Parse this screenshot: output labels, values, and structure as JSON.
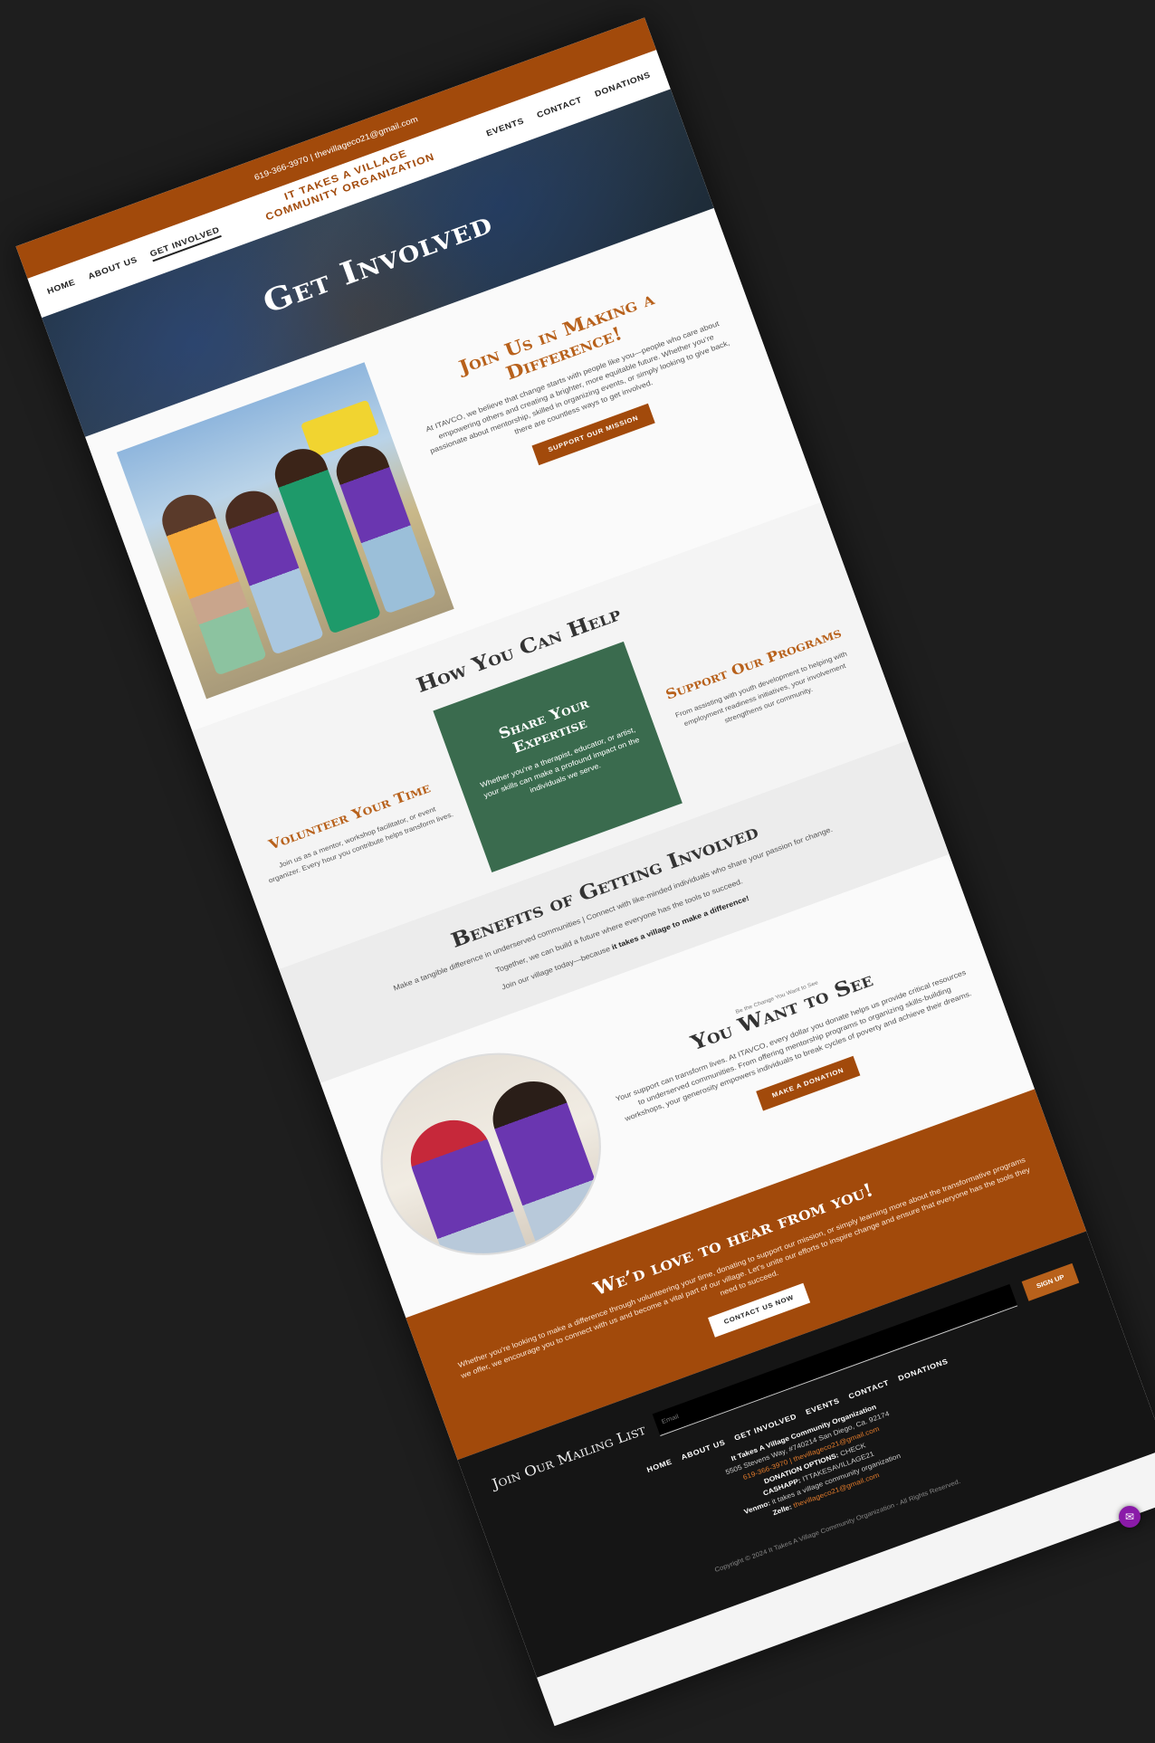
{
  "header": {
    "contact_line": "619-366-3970 | thevillageco21@gmail.com",
    "brand_line1": "IT TAKES A VILLAGE",
    "brand_line2": "COMMUNITY ORGANIZATION",
    "nav_left": [
      "HOME",
      "ABOUT US",
      "GET INVOLVED"
    ],
    "nav_right": [
      "EVENTS",
      "CONTACT",
      "DONATIONS"
    ]
  },
  "hero": {
    "title": "Get Involved"
  },
  "join": {
    "title": "Join Us in Making a Difference!",
    "body": "At ITAVCO, we believe that change starts with people like you—people who care about empowering others and creating a brighter, more equitable future. Whether you’re passionate about mentorship, skilled in organizing events, or simply looking to give back, there are countless ways to get involved.",
    "button": "SUPPORT OUR MISSION"
  },
  "help": {
    "title": "How You Can Help",
    "volunteer": {
      "title": "Volunteer Your Time",
      "body": "Join us as a mentor, workshop facilitator, or event organizer. Every hour you contribute helps transform lives."
    },
    "expertise": {
      "title": "Share Your Expertise",
      "body": "Whether you’re a therapist, educator, or artist, your skills can make a profound impact on the individuals we serve."
    },
    "programs": {
      "title": "Support Our Programs",
      "body": "From assisting with youth development to helping with employment readiness initiatives, your involvement strengthens our community."
    }
  },
  "benefits": {
    "title": "Benefits of Getting Involved",
    "line1": "Make a tangible difference in underserved communities | Connect with like-minded individuals who share your passion for change.",
    "line2": "Together, we can build a future where everyone has the tools to succeed.",
    "line3_prefix": "Join our village today—because ",
    "line3_bold": "it takes a village to make a difference!"
  },
  "see": {
    "kicker": "Be the Change You Want to See",
    "title": "You Want to See",
    "body": "Your support can transform lives. At ITAVCO, every dollar you donate helps us provide critical resources to underserved communities. From offering mentorship programs to organizing skills-building workshops, your generosity empowers individuals to break cycles of poverty and achieve their dreams.",
    "button": "MAKE A DONATION"
  },
  "contact_band": {
    "title": "We’d love to hear from you!",
    "body": "Whether you’re looking to make a difference through volunteering your time, donating to support our mission, or simply learning more about the transformative programs we offer, we encourage you to connect with us and become a vital part of our village. Let’s unite our efforts to inspire change and ensure that everyone has the tools they need to succeed.",
    "button": "CONTACT US NOW"
  },
  "footer": {
    "mailing_title": "Join Our Mailing List",
    "email_placeholder": "Email",
    "signup": "SIGN UP",
    "nav": [
      "HOME",
      "ABOUT US",
      "GET INVOLVED",
      "EVENTS",
      "CONTACT",
      "DONATIONS"
    ],
    "org_name": "It Takes A Village Community Organization",
    "address": "5505 Stevens Way, #740214 San Diego, Ca. 92174",
    "phone_email": "619-366-3970 | thevillageco21@gmail.com",
    "donation_label": "DONATION OPTIONS:",
    "donation_value": "CHECK",
    "cashapp_label": "CASHAPP:",
    "cashapp_value": "ITTAKESAVILLAGE21",
    "venmo_label": "Venmo:",
    "venmo_value": "it takes a village community organization",
    "zelle_label": "Zelle:",
    "zelle_value": "thevillageco21@gmail.com",
    "copyright": "Copyright © 2024 It Takes A Village Community Organization - All Rights Reserved."
  },
  "colors": {
    "accent": "#a24a0b",
    "green": "#3a6b4e",
    "dark": "#151515"
  },
  "icons": {
    "chat": "chat-icon"
  }
}
